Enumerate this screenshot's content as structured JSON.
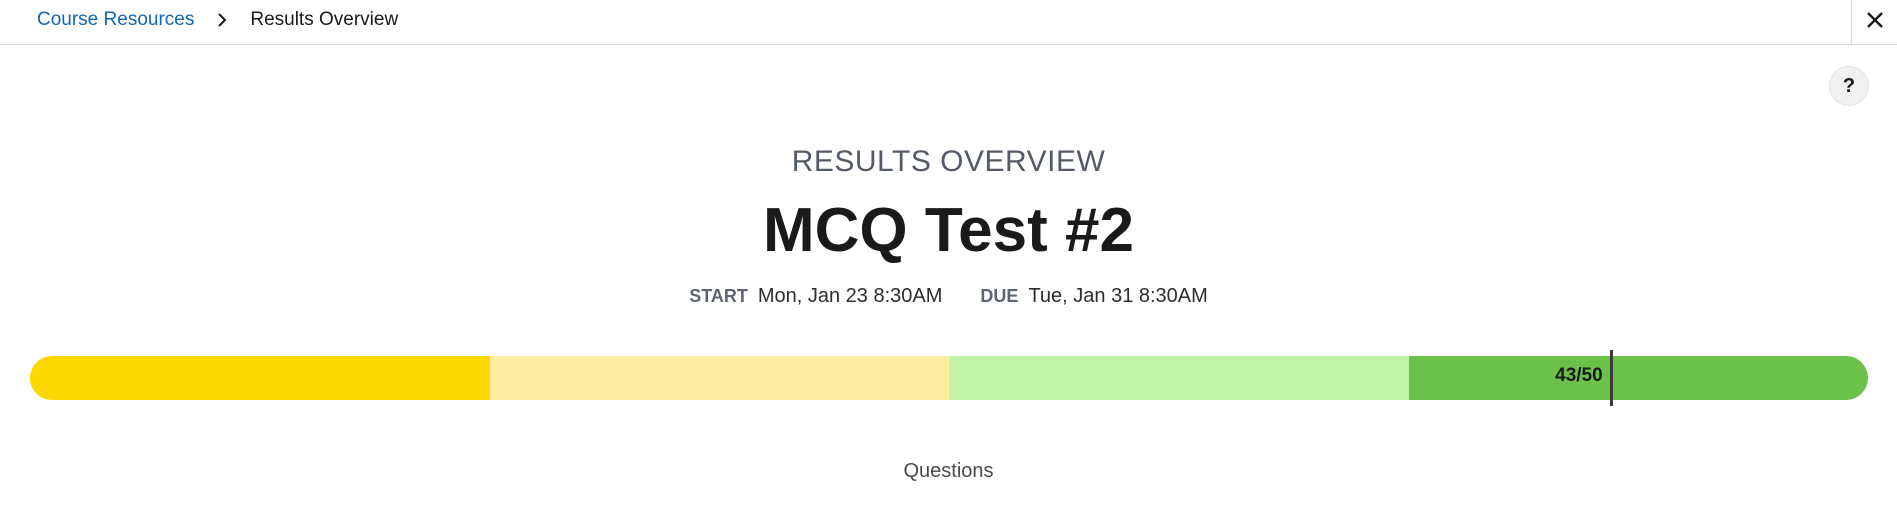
{
  "breadcrumb": {
    "parent": "Course Resources",
    "current": "Results Overview",
    "separator_icon": "chevron-right-icon"
  },
  "header": {
    "close_icon": "close-icon",
    "help_label": "?"
  },
  "results": {
    "overline": "RESULTS OVERVIEW",
    "title": "MCQ Test #2",
    "start_label": "START",
    "start_value": "Mon, Jan 23 8:30AM",
    "due_label": "DUE",
    "due_value": "Tue, Jan 31 8:30AM"
  },
  "score": {
    "label": "43/50",
    "earned": 43,
    "total": 50,
    "band_colors": [
      "#fdd700",
      "#feeca2",
      "#c0f5a9",
      "#6cc14a"
    ]
  },
  "sections": {
    "questions_heading": "Questions"
  }
}
